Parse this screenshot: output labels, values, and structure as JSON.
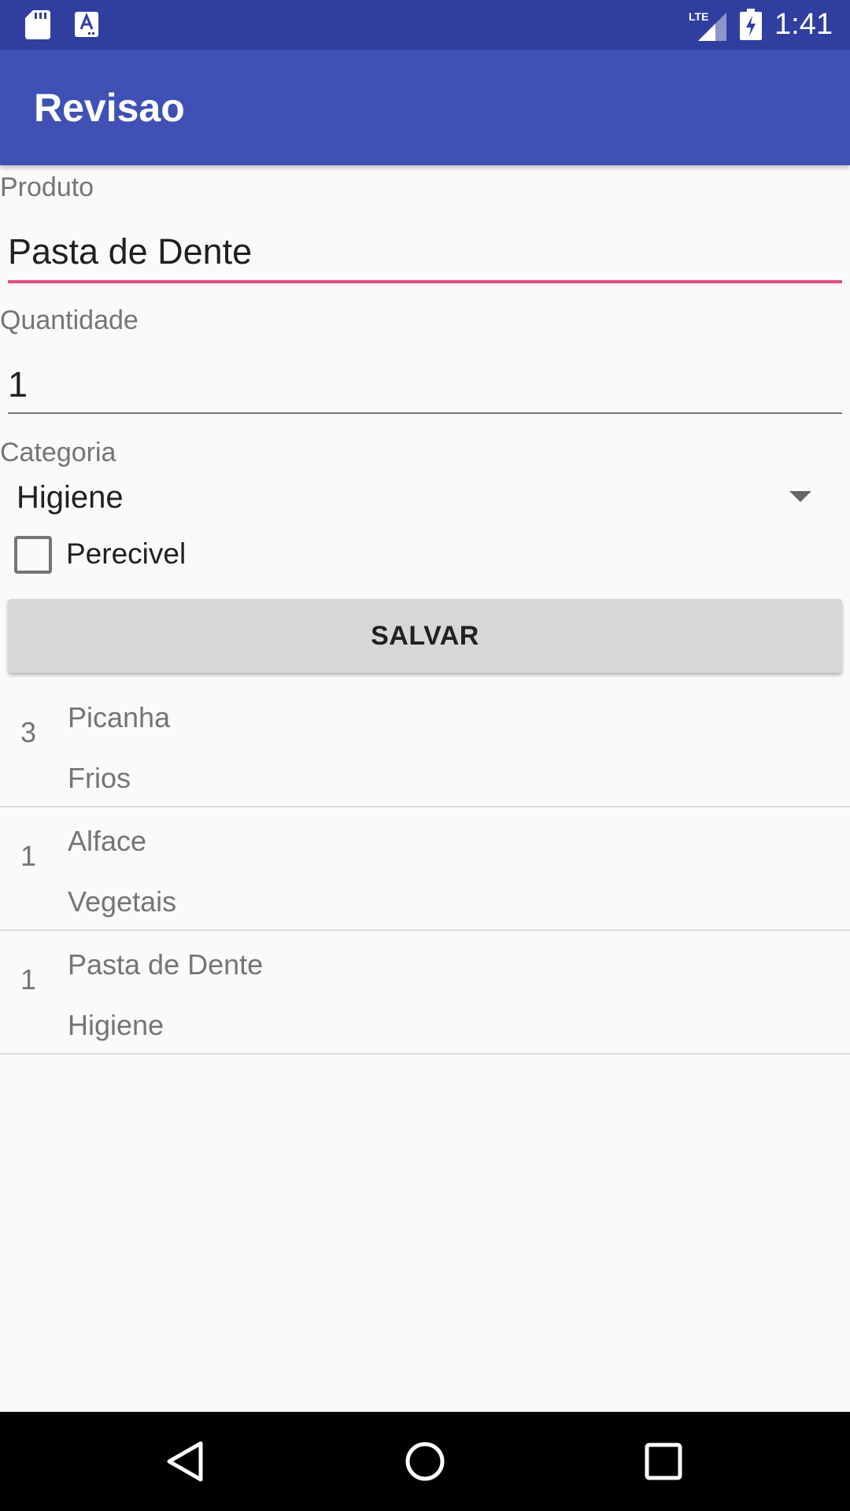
{
  "status_bar": {
    "time": "1:41",
    "network": "LTE",
    "icons": [
      "sd-card-icon",
      "keyboard-a-icon",
      "lte-signal-icon",
      "battery-charging-icon"
    ]
  },
  "toolbar": {
    "title": "Revisao"
  },
  "form": {
    "produto_label": "Produto",
    "produto_value": "Pasta de Dente",
    "quantidade_label": "Quantidade",
    "quantidade_value": "1",
    "categoria_label": "Categoria",
    "categoria_selected": "Higiene",
    "perecivel_label": "Perecivel",
    "perecivel_checked": false,
    "save_label": "SALVAR"
  },
  "items": [
    {
      "quantity": "3",
      "name": "Picanha",
      "category": "Frios"
    },
    {
      "quantity": "1",
      "name": "Alface",
      "category": "Vegetais"
    },
    {
      "quantity": "1",
      "name": "Pasta de Dente",
      "category": "Higiene"
    }
  ],
  "navigation": {
    "buttons": [
      "back-icon",
      "home-icon",
      "recents-icon"
    ]
  },
  "colors": {
    "status_bar": "#303f9f",
    "primary": "#3f51b5",
    "accent": "#e84a7e",
    "background": "#fafafa",
    "button": "#d6d7d7"
  }
}
